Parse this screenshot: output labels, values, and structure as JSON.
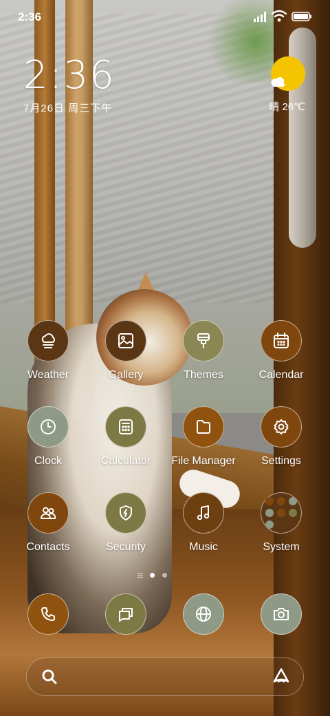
{
  "status_bar": {
    "time": "2:36"
  },
  "clock_widget": {
    "time": "2:36",
    "date": "7月26日 周三下午"
  },
  "weather_widget": {
    "text": "晴 26℃",
    "icon": "sunny-cloud-icon"
  },
  "colors": {
    "dark_brown": "#6e3f10",
    "amber": "#8f520f",
    "olive": "#7d7945",
    "sage": "#8e9a85",
    "slate": "#7d8877",
    "sun": "#f5c400"
  },
  "apps": [
    {
      "name": "weather",
      "label": "Weather",
      "icon": "weather-icon",
      "color": "#5b3614"
    },
    {
      "name": "gallery",
      "label": "Gallery",
      "icon": "gallery-icon",
      "color": "#5b3614"
    },
    {
      "name": "themes",
      "label": "Themes",
      "icon": "paintbrush-icon",
      "color": "#8a8754"
    },
    {
      "name": "calendar",
      "label": "Calendar",
      "icon": "calendar-icon",
      "color": "#7f470e"
    },
    {
      "name": "clock",
      "label": "Clock",
      "icon": "clock-icon",
      "color": "#8e9a85"
    },
    {
      "name": "calculator",
      "label": "Calculator",
      "icon": "calculator-icon",
      "color": "#7d7945"
    },
    {
      "name": "file-manager",
      "label": "File Manager",
      "icon": "folder-icon",
      "color": "#8f520f"
    },
    {
      "name": "settings",
      "label": "Settings",
      "icon": "gear-icon",
      "color": "#7f470e"
    },
    {
      "name": "contacts",
      "label": "Contacts",
      "icon": "contacts-icon",
      "color": "#7f470e"
    },
    {
      "name": "security",
      "label": "Security",
      "icon": "shield-icon",
      "color": "#7d7945"
    },
    {
      "name": "music",
      "label": "Music",
      "icon": "music-note-icon",
      "color": "#6e3f10"
    },
    {
      "name": "system",
      "label": "System",
      "icon": "folder-grid-icon",
      "color": "#5b3614"
    }
  ],
  "dock": [
    {
      "name": "phone",
      "icon": "phone-icon",
      "color": "#8f520f"
    },
    {
      "name": "messages",
      "icon": "message-icon",
      "color": "#7d7945"
    },
    {
      "name": "browser",
      "icon": "globe-icon",
      "color": "#8e9a85"
    },
    {
      "name": "camera",
      "icon": "camera-icon",
      "color": "#8e9a85"
    }
  ],
  "page_indicator": {
    "pages": 2,
    "current": 1
  },
  "search_bar": {
    "left_icon": "search-icon",
    "right_icon": "assistant-icon"
  }
}
